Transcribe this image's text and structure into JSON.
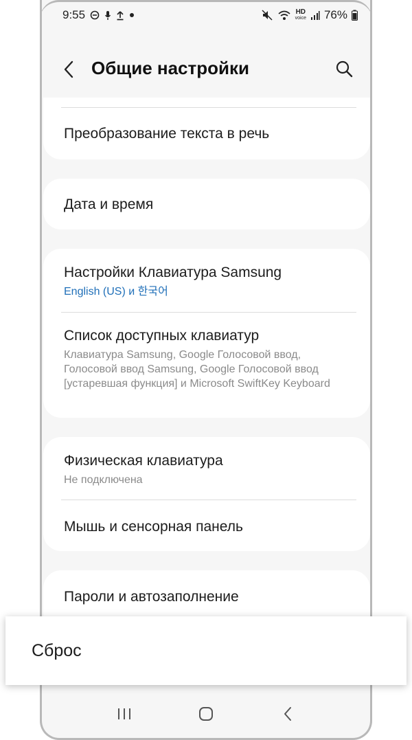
{
  "status_bar": {
    "time": "9:55",
    "battery": "76%",
    "hd_label": "HD",
    "voice_label": "voice"
  },
  "header": {
    "title": "Общие настройки"
  },
  "sections": [
    {
      "items": [
        {
          "title": "Преобразование текста в речь"
        }
      ]
    },
    {
      "items": [
        {
          "title": "Дата и время"
        }
      ]
    },
    {
      "items": [
        {
          "title": "Настройки Клавиатура Samsung",
          "subtitle": "English (US) и 한국어",
          "subtitle_color": "#1f6fb8"
        },
        {
          "title": "Список доступных клавиатур",
          "subtitle": "Клавиатура Samsung, Google Голосовой ввод, Голосовой ввод Samsung, Google Голосовой ввод [устаревшая функция] и Microsoft SwiftKey Keyboard"
        }
      ]
    },
    {
      "items": [
        {
          "title": "Физическая клавиатура",
          "subtitle": "Не подключена"
        },
        {
          "title": "Мышь и сенсорная панель"
        }
      ]
    },
    {
      "items": [
        {
          "title": "Пароли и автозаполнение"
        }
      ]
    }
  ],
  "highlight": {
    "label": "Сброс"
  },
  "icons": {
    "back": "chevron-left-icon",
    "search": "search-icon",
    "nav_recents": "recents-icon",
    "nav_home": "home-icon",
    "nav_back": "back-icon"
  }
}
